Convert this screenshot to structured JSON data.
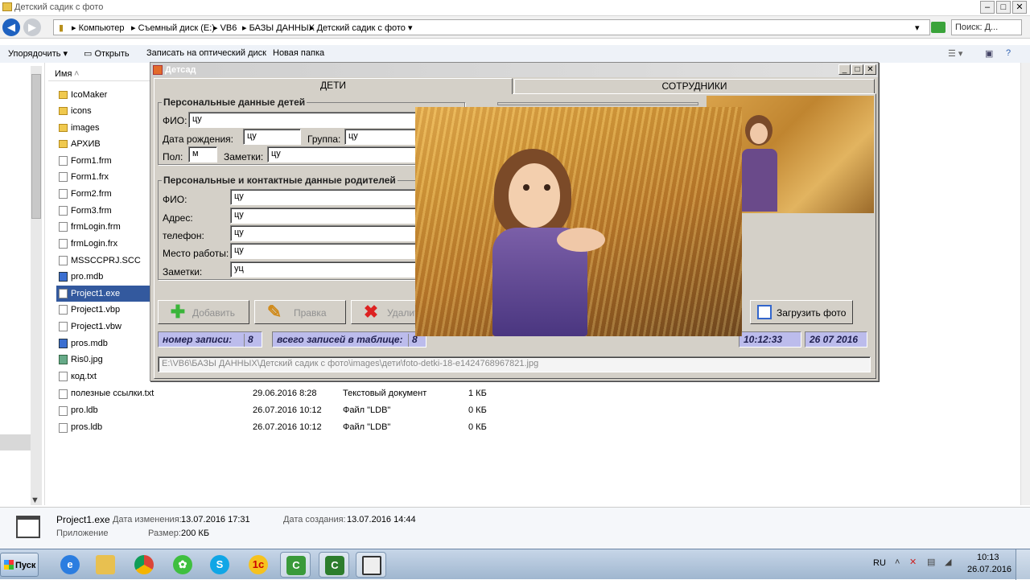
{
  "explorer": {
    "title": "Детский садик с фото",
    "address": [
      "Компьютер",
      "Съемный диск (E:)",
      "VB6",
      "БАЗЫ ДАННЫХ",
      "Детский садик с фото"
    ],
    "search_placeholder": "Поиск: Д...",
    "toolbar": {
      "organize": "Упорядочить",
      "open": "Открыть",
      "burn": "Записать на оптический диск",
      "new_folder": "Новая папка"
    },
    "column_name": "Имя",
    "files": [
      {
        "name": "IcoMaker",
        "icon": "folder-icon"
      },
      {
        "name": "icons",
        "icon": "folder-icon"
      },
      {
        "name": "images",
        "icon": "folder-icon"
      },
      {
        "name": "АРХИВ",
        "icon": "folder-icon"
      },
      {
        "name": "Form1.frm",
        "icon": "file-icon"
      },
      {
        "name": "Form1.frx",
        "icon": "file-icon"
      },
      {
        "name": "Form2.frm",
        "icon": "file-icon"
      },
      {
        "name": "Form3.frm",
        "icon": "file-icon"
      },
      {
        "name": "frmLogin.frm",
        "icon": "file-icon"
      },
      {
        "name": "frmLogin.frx",
        "icon": "file-icon"
      },
      {
        "name": "MSSCCPRJ.SCC",
        "icon": "file-icon"
      },
      {
        "name": "pro.mdb",
        "icon": "database-icon"
      },
      {
        "name": "Project1.exe",
        "icon": "exe-icon",
        "selected": true
      },
      {
        "name": "Project1.vbp",
        "icon": "file-icon"
      },
      {
        "name": "Project1.vbw",
        "icon": "file-icon"
      },
      {
        "name": "pros.mdb",
        "icon": "database-icon"
      },
      {
        "name": "Ris0.jpg",
        "icon": "image-icon"
      },
      {
        "name": "код.txt",
        "icon": "file-icon"
      }
    ],
    "detail_rows": [
      {
        "name": "полезные ссылки.txt",
        "date": "29.06.2016 8:28",
        "type": "Текстовый документ",
        "size": "1 КБ"
      },
      {
        "name": "pro.ldb",
        "date": "26.07.2016 10:12",
        "type": "Файл \"LDB\"",
        "size": "0 КБ"
      },
      {
        "name": "pros.ldb",
        "date": "26.07.2016 10:12",
        "type": "Файл \"LDB\"",
        "size": "0 КБ"
      }
    ],
    "details": {
      "name": "Project1.exe",
      "kind": "Приложение",
      "modified_label": "Дата изменения:",
      "modified": "13.07.2016 17:31",
      "created_label": "Дата создания:",
      "created": "13.07.2016 14:44",
      "size_label": "Размер:",
      "size": "200 КБ"
    }
  },
  "app": {
    "title": "Детсад",
    "tabs": [
      "ДЕТИ",
      "СОТРУДНИКИ"
    ],
    "kids_group": "Персональные данные детей",
    "parents_group": "Персональные и контактные данные родителей",
    "kid": {
      "fio_label": "ФИО:",
      "fio": "цу",
      "dob_label": "Дата рождения:",
      "dob": "цу",
      "group_label": "Группа:",
      "group": "цу",
      "sex_label": "Пол:",
      "sex": "м",
      "notes_label": "Заметки:",
      "notes": "цу"
    },
    "parent": {
      "fio_label": "ФИО:",
      "fio": "цу",
      "address_label": "Адрес:",
      "address": "цу",
      "phone_label": "телефон:",
      "phone": "цу",
      "work_label": "Место работы:",
      "work": "цу",
      "notes_label": "Заметки:",
      "notes": "уц"
    },
    "buttons": {
      "add": "Добавить",
      "edit": "Правка",
      "delete": "Удалить",
      "load_photo": "Загрузить фото"
    },
    "status": {
      "record_label": "номер записи:",
      "record": "8",
      "total_label": "всего записей в таблице:",
      "total": "8",
      "time": "10:12:33",
      "date": "26 07 2016"
    },
    "path": "E:\\VB6\\БАЗЫ ДАННЫХ\\Детский садик с фото\\images\\дети\\foto-detki-18-e1424768967821.jpg"
  },
  "taskbar": {
    "start": "Пуск",
    "apps": [
      "internet-explorer-icon",
      "file-explorer-icon",
      "chrome-icon",
      "icq-icon",
      "skype-icon",
      "1c-icon",
      "camtasia-icon",
      "camtasia-recorder-icon",
      "vb-app-icon"
    ],
    "lang": "RU",
    "time": "10:13",
    "date": "26.07.2016"
  },
  "colors": {
    "selection": "#33599e",
    "form_bg": "#d4d0c8",
    "status_bg": "#bcbcec"
  }
}
